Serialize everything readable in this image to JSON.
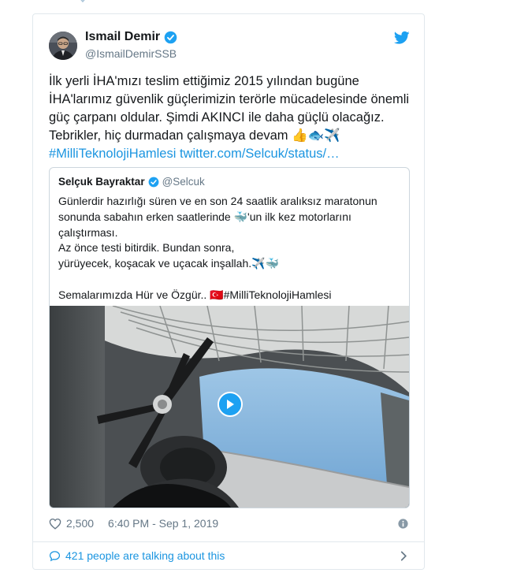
{
  "tweet": {
    "author_name": "Ismail Demir",
    "author_handle": "@IsmailDemirSSB",
    "text_lines": [
      "İlk yerli İHA'mızı teslim ettiğimiz 2015 yılından bugüne",
      "İHA'larımız güvenlik güçlerimizin terörle mücadelesinde önemli",
      "güç çarpanı oldular. Şimdi AKINCI ile daha güçlü olacağız.",
      "Tebrikler, hiç durmadan çalışmaya devam 👍🐟✈️"
    ],
    "hashtag": "#MilliTeknolojiHamlesi",
    "link": "twitter.com/Selcuk/status/…",
    "likes": "2,500",
    "time": "6:40 PM - Sep 1, 2019",
    "talking": "421 people are talking about this"
  },
  "quote": {
    "name": "Selçuk Bayraktar",
    "handle": "@Selcuk",
    "lines": [
      "Günlerdir hazırlığı süren ve en son 24 saatlik aralıksız maratonun",
      "sonunda sabahın erken saatlerinde 🐳'un ilk kez motorlarını",
      "çalıştırması.",
      "Az önce testi bitirdik. Bundan sonra,",
      "yürüyecek, koşacak ve uçacak inşallah.✈️🐳",
      "",
      "Semalarımızda Hür ve Özgür.. 🇹🇷#MilliTeknolojiHamlesi"
    ]
  },
  "colors": {
    "link": "#1b95e0",
    "twitter_blue": "#1da1f2",
    "muted": "#657786",
    "border": "#e1e8ed"
  },
  "icons": [
    "verified-icon",
    "twitter-bird-icon",
    "play-icon",
    "heart-icon",
    "info-icon",
    "comment-icon",
    "chevron-right-icon"
  ]
}
